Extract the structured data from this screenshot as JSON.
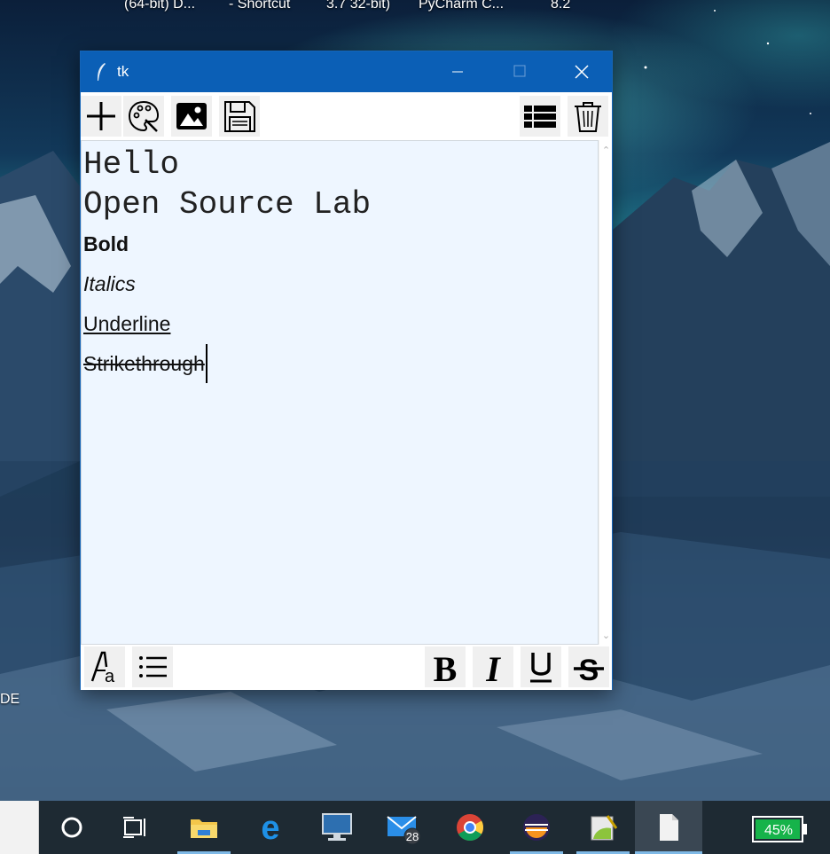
{
  "desktop": {
    "top_labels": [
      "(64-bit) D...",
      "- Shortcut",
      "3.7 32-bit)",
      "PyCharm C...",
      "8.2"
    ],
    "left_label": "DE"
  },
  "window": {
    "title": "tk",
    "toolbar": {
      "new_icon": "plus-icon",
      "palette_icon": "palette-icon",
      "image_icon": "image-icon",
      "save_icon": "floppy-disk-icon",
      "list_view_icon": "list-view-icon",
      "delete_icon": "trash-icon"
    },
    "editor": {
      "mono_lines": [
        "Hello",
        "Open Source Lab"
      ],
      "bold_text": "Bold",
      "italic_text": "Italics",
      "underline_text": "Underline",
      "strike_text": "Strikethrough",
      "background": "#eef6ff"
    },
    "bottombar": {
      "font_icon": "font-style-icon",
      "bullets_icon": "bullet-list-icon",
      "bold_icon": "bold-icon",
      "italic_icon": "italic-icon",
      "underline_icon": "underline-icon",
      "strike_icon": "strikethrough-icon"
    },
    "accent": "#0b5fb6"
  },
  "taskbar": {
    "mail_badge": "28",
    "battery_percent": "45%",
    "apps": [
      "cortana",
      "task-view",
      "file-explorer",
      "edge",
      "lenovo",
      "mail",
      "chrome",
      "eclipse",
      "notepad-plus",
      "tk-window"
    ]
  }
}
